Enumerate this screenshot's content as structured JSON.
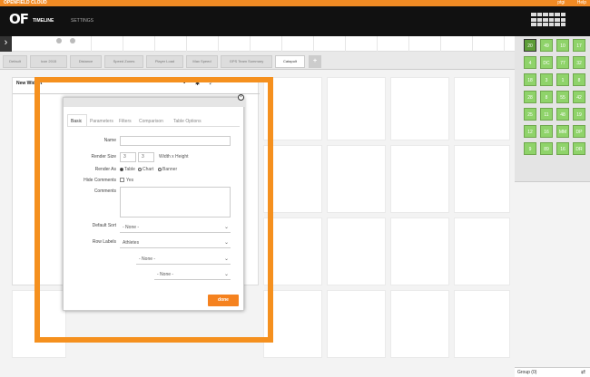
{
  "app": {
    "brand": "OPENFIELD CLOUD",
    "topbar_links": [
      "ptgi",
      "Help"
    ],
    "logo": "OF"
  },
  "nav": {
    "items": [
      {
        "label": "TIMELINE",
        "active": true
      },
      {
        "label": "SETTINGS",
        "active": false
      }
    ]
  },
  "tabs": [
    {
      "label": "Default",
      "active": false
    },
    {
      "label": "Icon 2015",
      "active": false
    },
    {
      "label": "Distance",
      "active": false
    },
    {
      "label": "Speed Zones",
      "active": false
    },
    {
      "label": "Player Load",
      "active": false
    },
    {
      "label": "Max Speed",
      "active": false
    },
    {
      "label": "GPS Team Summary",
      "active": false
    },
    {
      "label": "Catapult",
      "active": true
    }
  ],
  "add_tab_label": "+",
  "widget": {
    "title": "New Widget"
  },
  "dialog": {
    "tabs": [
      "Basic",
      "Parameters",
      "Filters",
      "Comparison",
      "Table Options"
    ],
    "active_tab": "Basic",
    "name_label": "Name",
    "name_value": "",
    "render_size_label": "Render Size",
    "render_w": "3",
    "render_h": "3",
    "render_hint": "Width x Height",
    "render_as_label": "Render As",
    "render_as_options": [
      "Table",
      "Chart",
      "Banner"
    ],
    "render_as_selected": "Table",
    "hide_comments_label": "Hide Comments",
    "hide_comments_option": "Yes",
    "comments_label": "Comments",
    "default_sort_label": "Default Sort",
    "default_sort_value": "- None -",
    "row_labels_label": "Row Labels",
    "row_labels_value": "Athletes",
    "row_labels_sub1": "- None -",
    "row_labels_sub2": "- None -",
    "done_label": "done"
  },
  "side_squares": [
    [
      "20",
      "49",
      "10",
      "17"
    ],
    [
      "4",
      "DC",
      "77",
      "32"
    ],
    [
      "18",
      "3",
      "1",
      "8"
    ],
    [
      "28",
      "8",
      "55",
      "42"
    ],
    [
      "25",
      "11",
      "48",
      "19"
    ],
    [
      "12",
      "16",
      "MM",
      "DP"
    ],
    [
      "9",
      "89",
      "16",
      "DR"
    ]
  ],
  "group": {
    "label": "Group (0)"
  },
  "colors": {
    "accent": "#f08a24",
    "highlight": "#f5901e",
    "square": "#8fd36a"
  }
}
